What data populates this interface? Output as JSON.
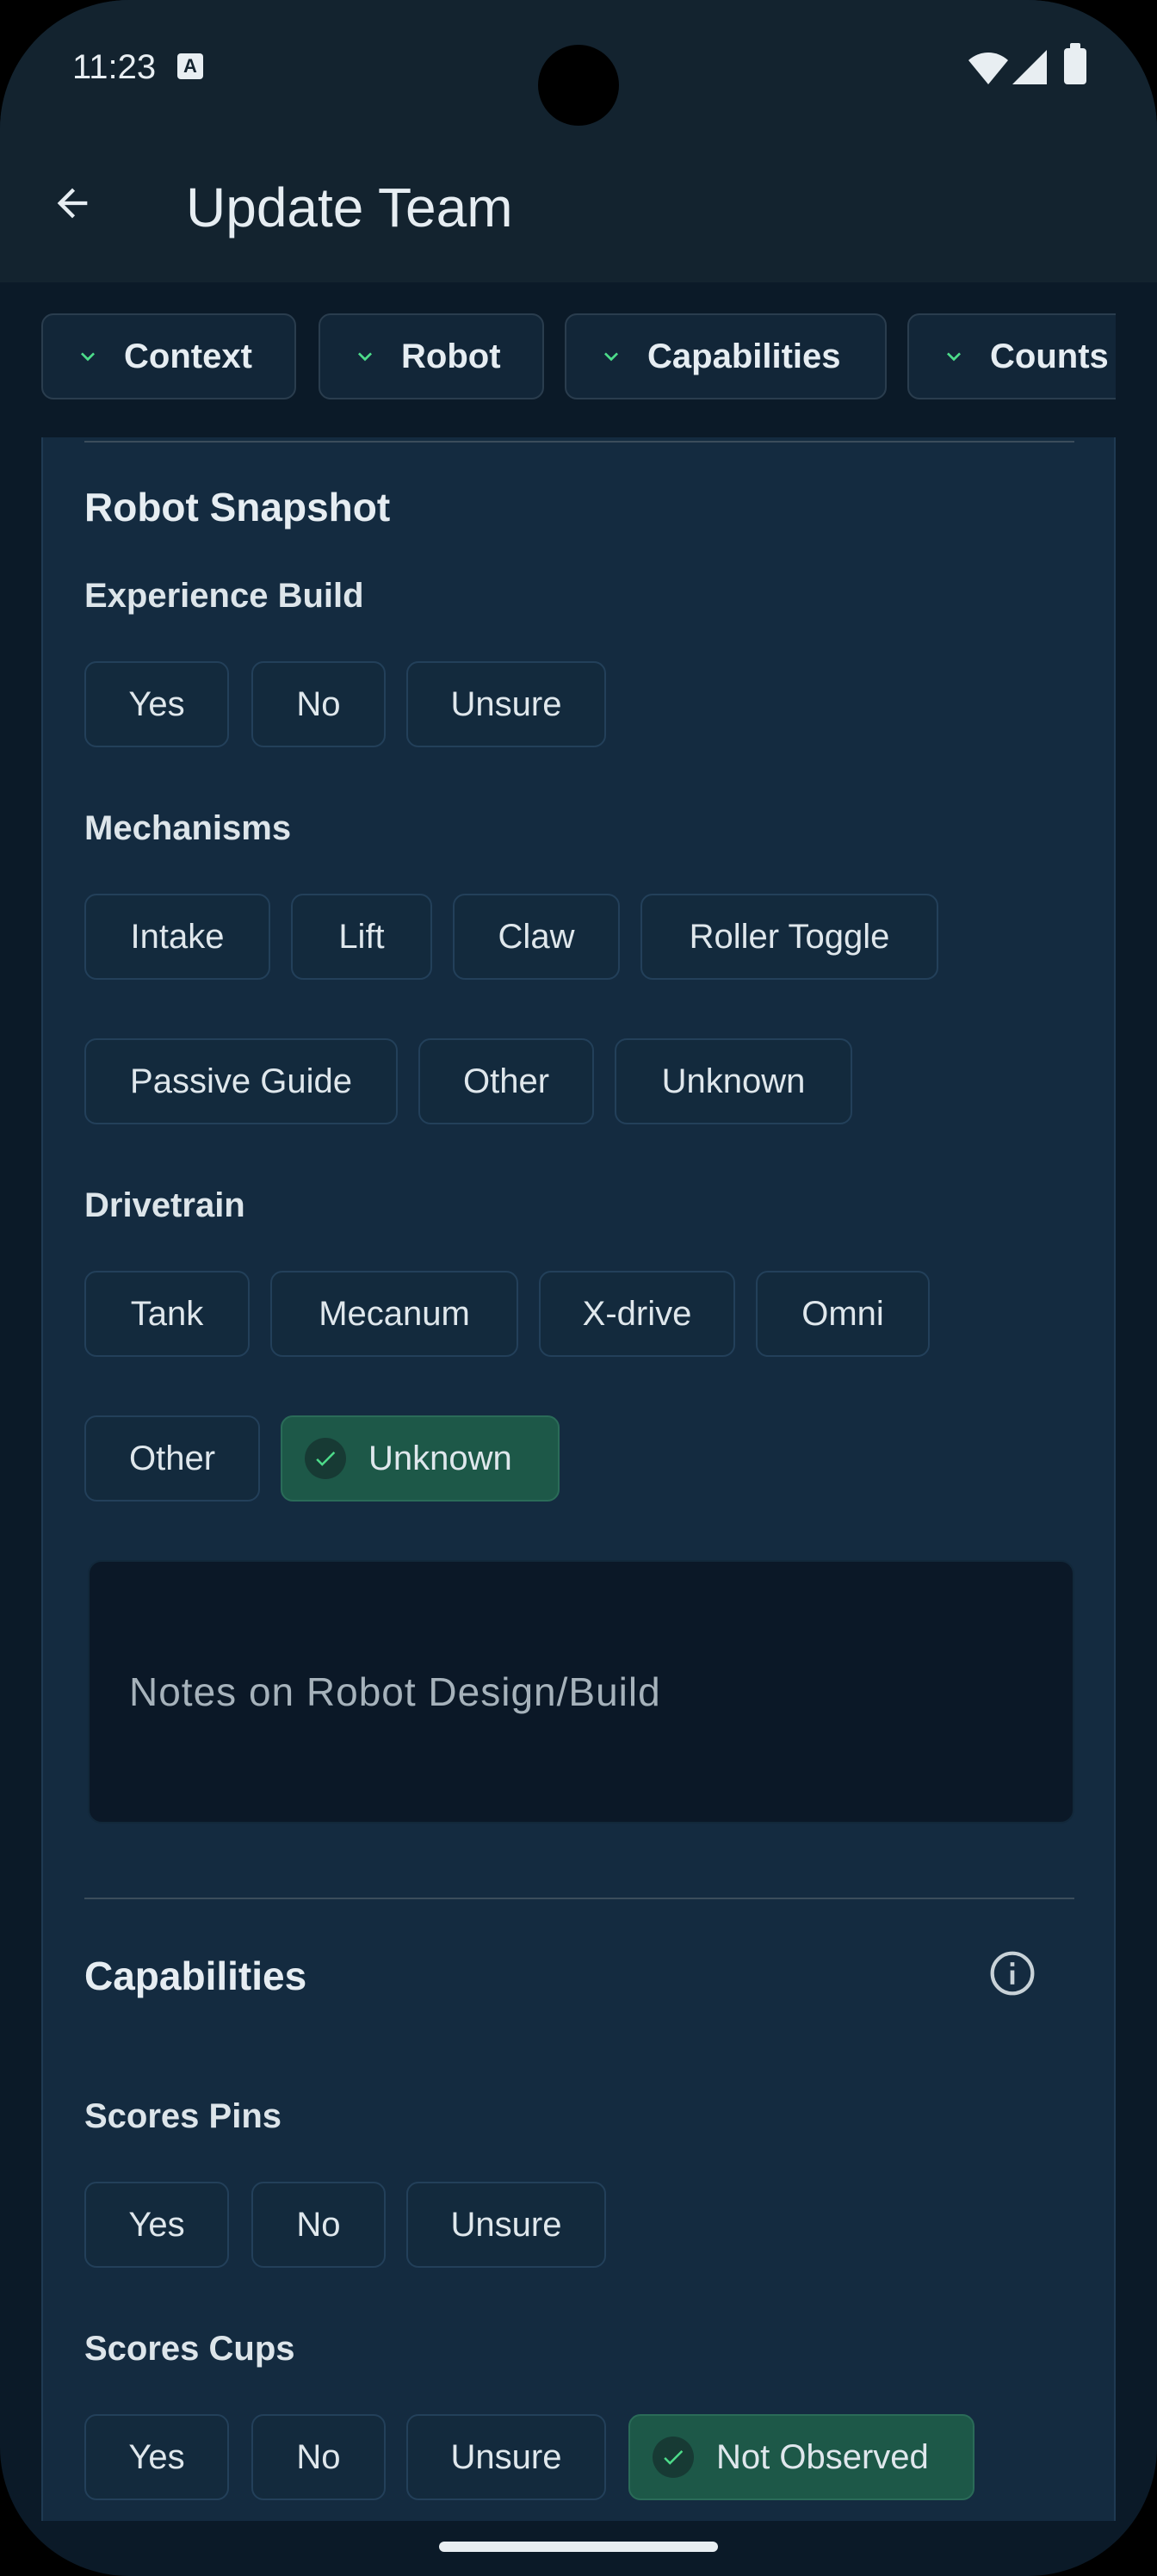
{
  "status_bar": {
    "time": "11:23",
    "a_icon": "A"
  },
  "app_bar": {
    "title": "Update Team"
  },
  "nav_chips": [
    {
      "label": "Context"
    },
    {
      "label": "Robot"
    },
    {
      "label": "Capabilities"
    },
    {
      "label": "Counts"
    }
  ],
  "robot_snapshot": {
    "title": "Robot Snapshot",
    "experience_build": {
      "label": "Experience Build",
      "options": [
        "Yes",
        "No",
        "Unsure"
      ]
    },
    "mechanisms": {
      "label": "Mechanisms",
      "options": [
        "Intake",
        "Lift",
        "Claw",
        "Roller Toggle",
        "Passive Guide",
        "Other",
        "Unknown"
      ]
    },
    "drivetrain": {
      "label": "Drivetrain",
      "options": [
        "Tank",
        "Mecanum",
        "X-drive",
        "Omni",
        "Other",
        "Unknown"
      ],
      "selected": "Unknown"
    },
    "notes_placeholder": "Notes on Robot Design/Build"
  },
  "capabilities": {
    "title": "Capabilities",
    "scores_pins": {
      "label": "Scores Pins",
      "options": [
        "Yes",
        "No",
        "Unsure"
      ]
    },
    "scores_cups": {
      "label": "Scores Cups",
      "options": [
        "Yes",
        "No",
        "Unsure",
        "Not Observed"
      ],
      "selected": "Not Observed"
    }
  },
  "colors": {
    "accent_green": "#4ddc8a",
    "selected_bg": "#1d5848"
  },
  "icons": [
    "back-arrow-icon",
    "chevron-down-icon",
    "check-icon",
    "info-icon",
    "wifi-icon",
    "signal-icon",
    "battery-icon"
  ]
}
